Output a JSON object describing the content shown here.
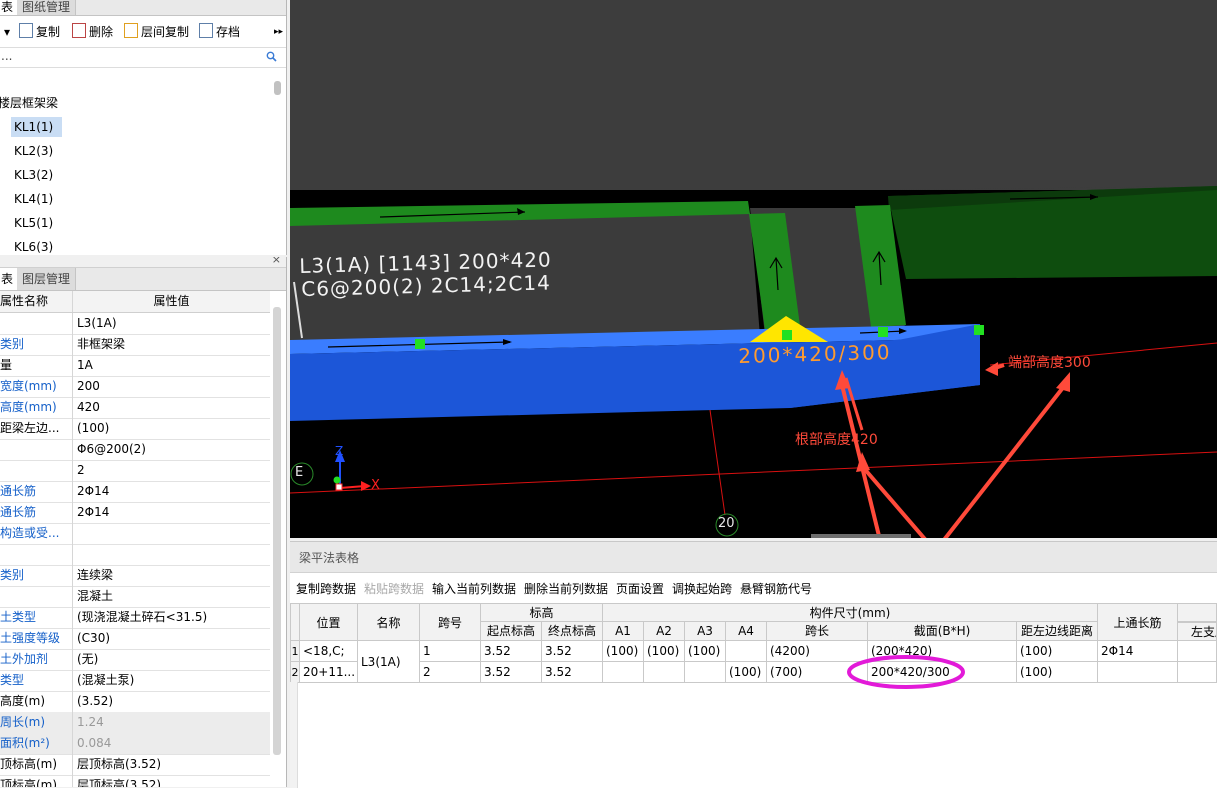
{
  "left_top": {
    "tabs": [
      "表",
      "图纸管理"
    ],
    "toolbar": {
      "copy": "复制",
      "delete": "删除",
      "floor_copy": "层间复制",
      "save": "存档"
    },
    "search_placeholder": "...",
    "tree_group": "楼层框架梁",
    "tree_items": [
      "KL1(1)",
      "KL2(3)",
      "KL3(2)",
      "KL4(1)",
      "KL5(1)",
      "KL6(3)"
    ]
  },
  "left_bottom": {
    "tabs": [
      "表",
      "图层管理"
    ],
    "header": {
      "name": "属性名称",
      "value": "属性值"
    },
    "rows": [
      {
        "name": "",
        "value": "L3(1A)",
        "blue": false
      },
      {
        "name": "类别",
        "value": "非框架梁",
        "blue": true
      },
      {
        "name": "量",
        "value": "1A",
        "blue": false
      },
      {
        "name": "宽度(mm)",
        "value": "200",
        "blue": true
      },
      {
        "name": "高度(mm)",
        "value": "420",
        "blue": true
      },
      {
        "name": "距梁左边...",
        "value": "(100)",
        "blue": false
      },
      {
        "name": "",
        "value": "Φ6@200(2)",
        "blue": false
      },
      {
        "name": "",
        "value": "2",
        "blue": false
      },
      {
        "name": "通长筋",
        "value": "2Φ14",
        "blue": true
      },
      {
        "name": "通长筋",
        "value": "2Φ14",
        "blue": true
      },
      {
        "name": "构造或受...",
        "value": "",
        "blue": true
      },
      {
        "name": "",
        "value": "",
        "blue": false
      },
      {
        "name": "类别",
        "value": "连续梁",
        "blue": true
      },
      {
        "name": "",
        "value": "混凝土",
        "blue": false
      },
      {
        "name": "土类型",
        "value": "(现浇混凝土碎石<31.5)",
        "blue": true
      },
      {
        "name": "土强度等级",
        "value": "(C30)",
        "blue": true
      },
      {
        "name": "土外加剂",
        "value": "(无)",
        "blue": true
      },
      {
        "name": "类型",
        "value": "(混凝土泵)",
        "blue": true
      },
      {
        "name": "高度(m)",
        "value": "(3.52)",
        "blue": false
      },
      {
        "name": "周长(m)",
        "value": "1.24",
        "blue": true,
        "gray": true
      },
      {
        "name": "面积(m²)",
        "value": "0.084",
        "blue": true,
        "gray": true
      },
      {
        "name": "顶标高(m)",
        "value": "层顶标高(3.52)",
        "blue": false
      },
      {
        "name": "顶标高(m)",
        "value": "层顶标高(3.52)",
        "blue": false
      }
    ]
  },
  "viewport": {
    "beam_label_line1": "L3(1A) [1143] 200*420",
    "beam_label_line2": "C6@200(2) 2C14;2C14",
    "beam_dim_label": "200*420/300",
    "axis_e": "E",
    "axis_20": "20",
    "axis_z": "Z",
    "axis_x": "X",
    "annotation_end": "端部高度300",
    "annotation_root": "根部高度420",
    "colors": {
      "beam_blue": "#1c56d8",
      "beam_green": "#1e8a1e",
      "dark_green": "#0e4d0e",
      "annot_red": "#ff4a3a",
      "circle_magenta": "#e21ad8",
      "slab_gray": "#3b3b3b"
    }
  },
  "table_panel": {
    "title": "梁平法表格",
    "tools": [
      "复制跨数据",
      "粘贴跨数据",
      "输入当前列数据",
      "删除当前列数据",
      "页面设置",
      "调换起始跨",
      "悬臂钢筋代号"
    ],
    "header_top": {
      "position": "位置",
      "name": "名称",
      "span_no": "跨号",
      "elevation": "标高",
      "member_size": "构件尺寸(mm)",
      "top_rebar": "上通长筋",
      "left_support": "左支座"
    },
    "header_sub": {
      "start_elev": "起点标高",
      "end_elev": "终点标高",
      "a1": "A1",
      "a2": "A2",
      "a3": "A3",
      "a4": "A4",
      "span_len": "跨长",
      "section": "截面(B*H)",
      "dist_left": "距左边线距离"
    },
    "rows": [
      {
        "idx": "1",
        "position": "<18,C;",
        "name": "L3(1A)",
        "span_no": "1",
        "start_elev": "3.52",
        "end_elev": "3.52",
        "a1": "(100)",
        "a2": "(100)",
        "a3": "(100)",
        "a4": "",
        "span_len": "(4200)",
        "section": "(200*420)",
        "dist_left": "(100)",
        "top_rebar": "2Φ14"
      },
      {
        "idx": "2",
        "position": "20+11...",
        "name": "",
        "span_no": "2",
        "start_elev": "3.52",
        "end_elev": "3.52",
        "a1": "",
        "a2": "",
        "a3": "",
        "a4": "(100)",
        "span_len": "(700)",
        "section": "200*420/300",
        "dist_left": "(100)",
        "top_rebar": ""
      }
    ]
  }
}
